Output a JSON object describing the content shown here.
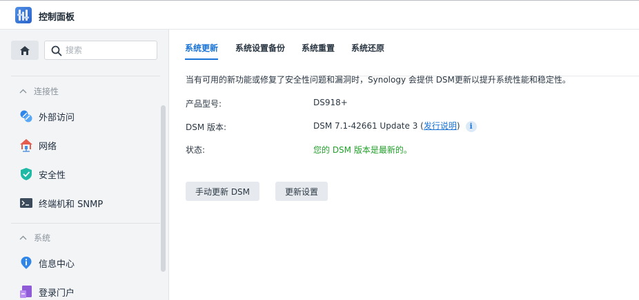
{
  "window": {
    "title": "控制面板"
  },
  "sidebar": {
    "search_placeholder": "搜索",
    "groups": [
      {
        "header": "连接性",
        "items": [
          {
            "label": "外部访问",
            "icon": "external-access-icon"
          },
          {
            "label": "网络",
            "icon": "network-house-icon"
          },
          {
            "label": "安全性",
            "icon": "shield-check-icon"
          },
          {
            "label": "终端机和 SNMP",
            "icon": "terminal-icon"
          }
        ]
      },
      {
        "header": "系统",
        "items": [
          {
            "label": "信息中心",
            "icon": "info-pin-icon"
          },
          {
            "label": "登录门户",
            "icon": "login-portal-icon"
          }
        ]
      }
    ]
  },
  "tabs": [
    {
      "label": "系统更新",
      "active": true
    },
    {
      "label": "系统设置备份",
      "active": false
    },
    {
      "label": "系统重置",
      "active": false
    },
    {
      "label": "系统还原",
      "active": false
    }
  ],
  "content": {
    "description": "当有可用的新功能或修复了安全性问题和漏洞时，Synology 会提供 DSM更新以提升系统性能和稳定性。",
    "model_label": "产品型号:",
    "model_value": "DS918+",
    "version_label": "DSM 版本:",
    "version_value_prefix": "DSM 7.1-42661 Update 3 (",
    "release_notes_link": "发行说明",
    "version_value_suffix": ")",
    "status_label": "状态:",
    "status_value": "您的 DSM 版本是最新的。"
  },
  "buttons": {
    "manual_update": "手动更新 DSM",
    "update_settings": "更新设置"
  },
  "colors": {
    "accent": "#1a73d6",
    "status_ok": "#21a02a",
    "sidebar_bg": "#f3f4f6"
  }
}
